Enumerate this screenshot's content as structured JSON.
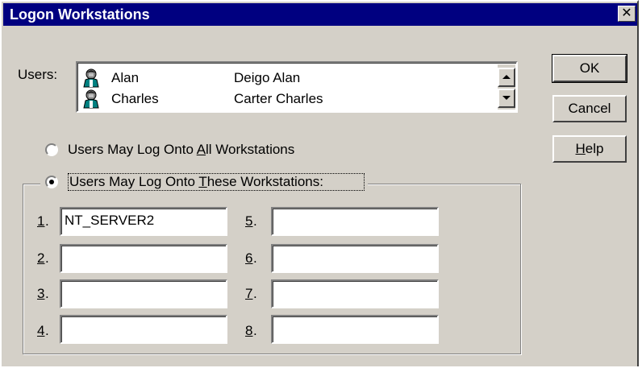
{
  "window": {
    "title": "Logon Workstations",
    "close_glyph": "✕"
  },
  "users_label": "Users:",
  "users": [
    {
      "name": "Alan",
      "full_name": "Deigo Alan",
      "icon": "user-icon"
    },
    {
      "name": "Charles",
      "full_name": "Carter Charles",
      "icon": "user-icon"
    }
  ],
  "buttons": {
    "ok": "OK",
    "cancel": "Cancel",
    "help_prefix": "",
    "help_mnemonic": "H",
    "help_rest": "elp"
  },
  "options": {
    "all": {
      "prefix": "Users May Log Onto ",
      "mnemonic": "A",
      "rest": "ll Workstations",
      "selected": false
    },
    "these": {
      "prefix": "Users May Log Onto ",
      "mnemonic": "T",
      "rest": "hese Workstations:",
      "selected": true
    }
  },
  "workstations": [
    {
      "num": "1",
      "value": "NT_SERVER2"
    },
    {
      "num": "2",
      "value": ""
    },
    {
      "num": "3",
      "value": ""
    },
    {
      "num": "4",
      "value": ""
    },
    {
      "num": "5",
      "value": ""
    },
    {
      "num": "6",
      "value": ""
    },
    {
      "num": "7",
      "value": ""
    },
    {
      "num": "8",
      "value": ""
    }
  ],
  "colors": {
    "titlebar": "#000080",
    "face": "#d4d0c8"
  }
}
